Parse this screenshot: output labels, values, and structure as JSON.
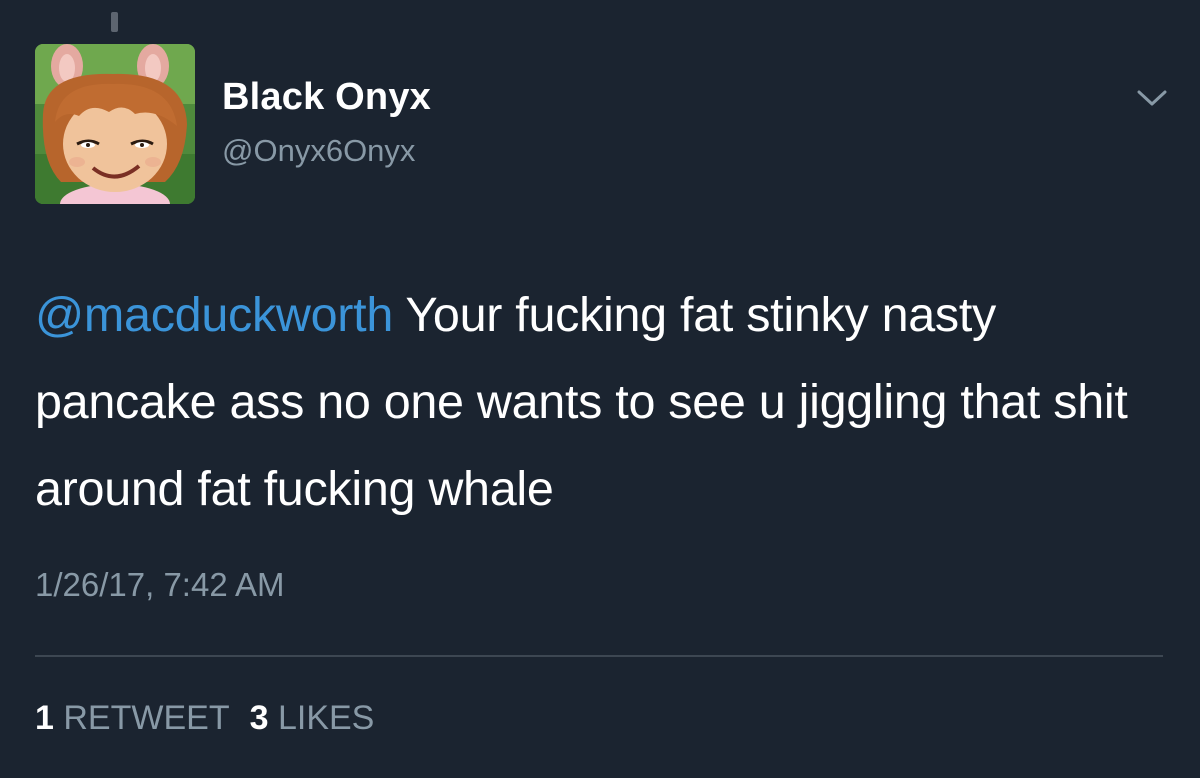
{
  "tweet": {
    "display_name": "Black Onyx",
    "handle": "@Onyx6Onyx",
    "mention": "@macduckworth",
    "text": " Your fucking fat stinky nasty pancake ass no one wants to see u jiggling that shit around fat fucking whale",
    "timestamp": "1/26/17, 7:42 AM",
    "retweet_count": "1",
    "retweet_label": "RETWEET",
    "like_count": "3",
    "like_label": "LIKES"
  },
  "icons": {
    "menu": "chevron-down-icon",
    "avatar": "cartoon-avatar"
  },
  "colors": {
    "background": "#1b2430",
    "mention": "#3b94d9",
    "secondary_text": "#8899a6",
    "primary_text": "#ffffff"
  }
}
